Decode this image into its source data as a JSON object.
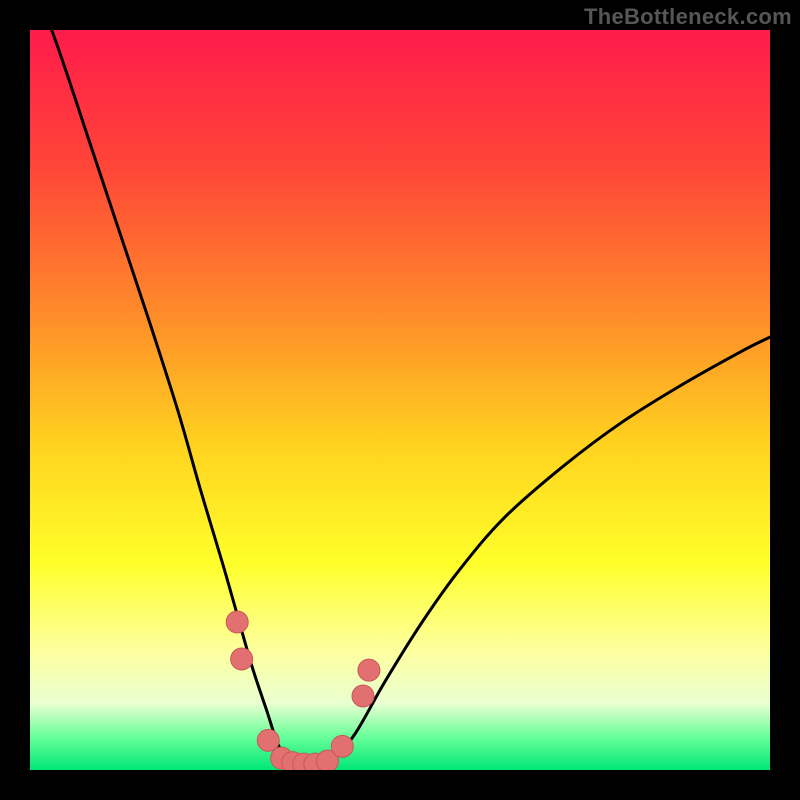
{
  "watermark": "TheBottleneck.com",
  "colors": {
    "frame": "#000000",
    "curve": "#000000",
    "dot_fill": "#e27070",
    "dot_stroke": "#c85858",
    "gradient_stops": [
      {
        "offset": 0.0,
        "color": "#ff1b4b"
      },
      {
        "offset": 0.18,
        "color": "#ff4438"
      },
      {
        "offset": 0.38,
        "color": "#ff8a2a"
      },
      {
        "offset": 0.56,
        "color": "#ffd21f"
      },
      {
        "offset": 0.72,
        "color": "#ffff2a"
      },
      {
        "offset": 0.84,
        "color": "#fdffa0"
      },
      {
        "offset": 0.91,
        "color": "#e9ffd0"
      },
      {
        "offset": 0.955,
        "color": "#68ff9a"
      },
      {
        "offset": 1.0,
        "color": "#00e676"
      }
    ]
  },
  "chart_data": {
    "type": "line",
    "title": "",
    "xlabel": "",
    "ylabel": "",
    "xlim": [
      0,
      100
    ],
    "ylim": [
      0,
      100
    ],
    "series": [
      {
        "name": "bottleneck-curve",
        "x": [
          0,
          4,
          8,
          12,
          16,
          20,
          23,
          26,
          28,
          30,
          32,
          33.5,
          35,
          37,
          39,
          41,
          44,
          48,
          53,
          58,
          64,
          72,
          80,
          88,
          96,
          100
        ],
        "values": [
          108,
          97,
          85,
          73,
          61,
          48.5,
          38,
          28,
          21,
          14,
          8,
          3.5,
          1.2,
          0.6,
          0.6,
          1.4,
          5,
          12,
          20,
          27,
          34,
          41,
          47,
          52,
          56.5,
          58.5
        ]
      }
    ],
    "points": [
      {
        "name": "p1",
        "x": 28.0,
        "y": 20.0
      },
      {
        "name": "p2",
        "x": 28.6,
        "y": 15.0
      },
      {
        "name": "p3",
        "x": 32.2,
        "y": 4.0
      },
      {
        "name": "p4",
        "x": 34.0,
        "y": 1.6
      },
      {
        "name": "p5",
        "x": 35.5,
        "y": 1.0
      },
      {
        "name": "p6",
        "x": 37.0,
        "y": 0.8
      },
      {
        "name": "p7",
        "x": 38.5,
        "y": 0.8
      },
      {
        "name": "p8",
        "x": 40.2,
        "y": 1.2
      },
      {
        "name": "p9",
        "x": 42.2,
        "y": 3.2
      },
      {
        "name": "p10",
        "x": 45.0,
        "y": 10.0
      },
      {
        "name": "p11",
        "x": 45.8,
        "y": 13.5
      }
    ]
  }
}
